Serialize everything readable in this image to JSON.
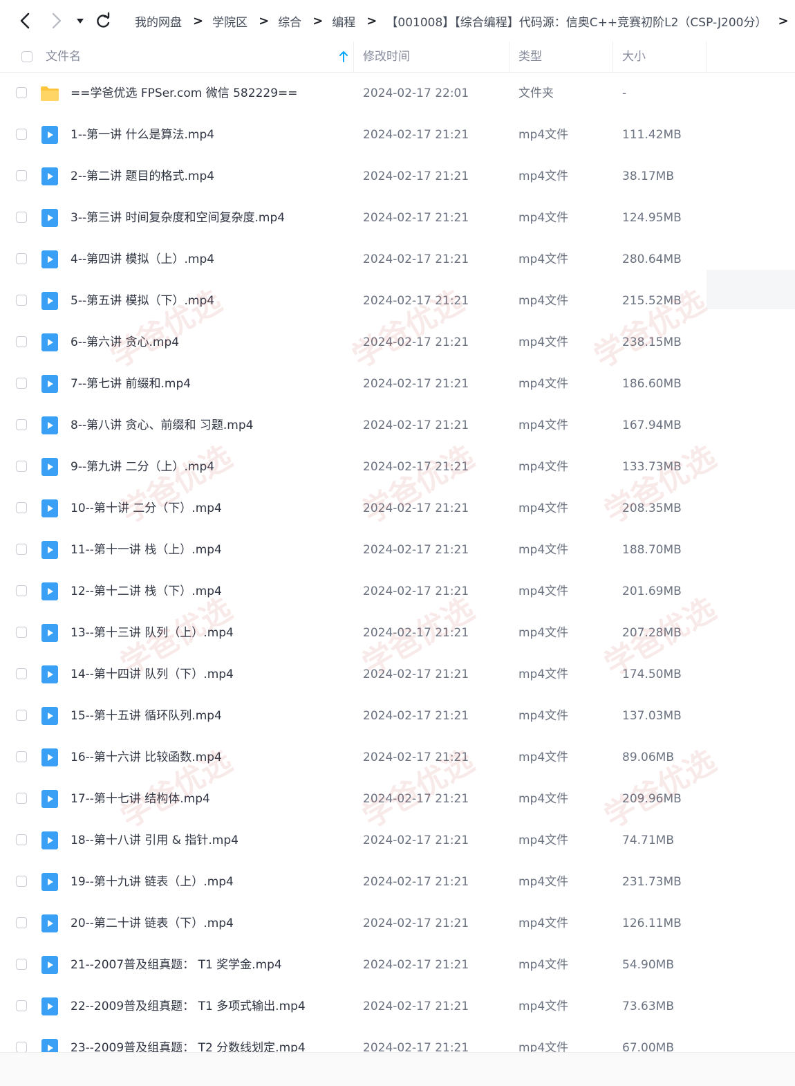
{
  "nav": {
    "back": "back-arrow",
    "forward": "forward-arrow",
    "history": "dropdown-caret",
    "refresh": "refresh-icon",
    "separator": ">"
  },
  "breadcrumbs": [
    "我的网盘",
    "学院区",
    "综合",
    "编程",
    "【001008】【综合编程】代码源：信奥C++竞赛初阶L2（CSP-J200分）"
  ],
  "columns": {
    "name": "文件名",
    "modified": "修改时间",
    "type": "类型",
    "size": "大小",
    "sort_icon": "sort-ascending-arrow"
  },
  "watermark": "学爸优选",
  "colors": {
    "accent": "#06a7ff",
    "folder": "#ffc53d",
    "video": "#3aa0f5"
  },
  "files": [
    {
      "name": "==学爸优选 FPSer.com 微信 582229==",
      "modified": "2024-02-17 22:01",
      "type": "文件夹",
      "size": "-",
      "icon": "folder"
    },
    {
      "name": "1--第一讲 什么是算法.mp4",
      "modified": "2024-02-17 21:21",
      "type": "mp4文件",
      "size": "111.42MB",
      "icon": "video"
    },
    {
      "name": "2--第二讲 题目的格式.mp4",
      "modified": "2024-02-17 21:21",
      "type": "mp4文件",
      "size": "38.17MB",
      "icon": "video"
    },
    {
      "name": "3--第三讲 时间复杂度和空间复杂度.mp4",
      "modified": "2024-02-17 21:21",
      "type": "mp4文件",
      "size": "124.95MB",
      "icon": "video"
    },
    {
      "name": "4--第四讲 模拟（上）.mp4",
      "modified": "2024-02-17 21:21",
      "type": "mp4文件",
      "size": "280.64MB",
      "icon": "video"
    },
    {
      "name": "5--第五讲 模拟（下）.mp4",
      "modified": "2024-02-17 21:21",
      "type": "mp4文件",
      "size": "215.52MB",
      "icon": "video"
    },
    {
      "name": "6--第六讲 贪心.mp4",
      "modified": "2024-02-17 21:21",
      "type": "mp4文件",
      "size": "238.15MB",
      "icon": "video"
    },
    {
      "name": "7--第七讲 前缀和.mp4",
      "modified": "2024-02-17 21:21",
      "type": "mp4文件",
      "size": "186.60MB",
      "icon": "video"
    },
    {
      "name": "8--第八讲 贪心、前缀和 习题.mp4",
      "modified": "2024-02-17 21:21",
      "type": "mp4文件",
      "size": "167.94MB",
      "icon": "video"
    },
    {
      "name": "9--第九讲 二分（上）.mp4",
      "modified": "2024-02-17 21:21",
      "type": "mp4文件",
      "size": "133.73MB",
      "icon": "video"
    },
    {
      "name": "10--第十讲 二分（下）.mp4",
      "modified": "2024-02-17 21:21",
      "type": "mp4文件",
      "size": "208.35MB",
      "icon": "video"
    },
    {
      "name": "11--第十一讲 栈（上）.mp4",
      "modified": "2024-02-17 21:21",
      "type": "mp4文件",
      "size": "188.70MB",
      "icon": "video"
    },
    {
      "name": "12--第十二讲 栈（下）.mp4",
      "modified": "2024-02-17 21:21",
      "type": "mp4文件",
      "size": "201.69MB",
      "icon": "video"
    },
    {
      "name": "13--第十三讲 队列（上）.mp4",
      "modified": "2024-02-17 21:21",
      "type": "mp4文件",
      "size": "207.28MB",
      "icon": "video"
    },
    {
      "name": "14--第十四讲 队列（下）.mp4",
      "modified": "2024-02-17 21:21",
      "type": "mp4文件",
      "size": "174.50MB",
      "icon": "video"
    },
    {
      "name": "15--第十五讲 循环队列.mp4",
      "modified": "2024-02-17 21:21",
      "type": "mp4文件",
      "size": "137.03MB",
      "icon": "video"
    },
    {
      "name": "16--第十六讲 比较函数.mp4",
      "modified": "2024-02-17 21:21",
      "type": "mp4文件",
      "size": "89.06MB",
      "icon": "video"
    },
    {
      "name": "17--第十七讲 结构体.mp4",
      "modified": "2024-02-17 21:21",
      "type": "mp4文件",
      "size": "209.96MB",
      "icon": "video"
    },
    {
      "name": "18--第十八讲 引用 & 指针.mp4",
      "modified": "2024-02-17 21:21",
      "type": "mp4文件",
      "size": "74.71MB",
      "icon": "video"
    },
    {
      "name": "19--第十九讲 链表（上）.mp4",
      "modified": "2024-02-17 21:21",
      "type": "mp4文件",
      "size": "231.73MB",
      "icon": "video"
    },
    {
      "name": "20--第二十讲 链表（下）.mp4",
      "modified": "2024-02-17 21:21",
      "type": "mp4文件",
      "size": "126.11MB",
      "icon": "video"
    },
    {
      "name": "21--2007普及组真题： T1 奖学金.mp4",
      "modified": "2024-02-17 21:21",
      "type": "mp4文件",
      "size": "54.90MB",
      "icon": "video"
    },
    {
      "name": "22--2009普及组真题： T1 多项式输出.mp4",
      "modified": "2024-02-17 21:21",
      "type": "mp4文件",
      "size": "73.63MB",
      "icon": "video"
    },
    {
      "name": "23--2009普及组真题： T2 分数线划定.mp4",
      "modified": "2024-02-17 21:21",
      "type": "mp4文件",
      "size": "67.00MB",
      "icon": "video"
    }
  ]
}
